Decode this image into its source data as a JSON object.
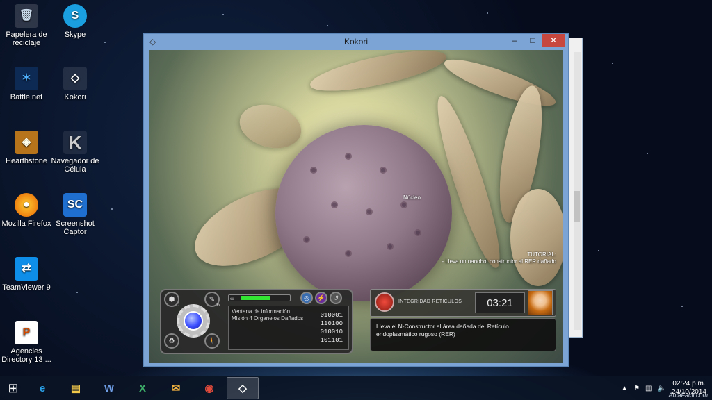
{
  "desktop": {
    "icons": [
      {
        "label": "Papelera de reciclaje",
        "icon": "recycle-bin-icon"
      },
      {
        "label": "Skype",
        "icon": "skype-icon"
      },
      {
        "label": "Battle.net",
        "icon": "battlenet-icon"
      },
      {
        "label": "Kokori",
        "icon": "unity-icon"
      },
      {
        "label": "Hearthstone",
        "icon": "hearthstone-icon"
      },
      {
        "label": "Navegador de Célula",
        "icon": "k-icon"
      },
      {
        "label": "Mozilla Firefox",
        "icon": "firefox-icon"
      },
      {
        "label": "Screenshot Captor",
        "icon": "sc-icon"
      },
      {
        "label": "TeamViewer 9",
        "icon": "teamviewer-icon"
      },
      {
        "label": "Agencies Directory 13 ...",
        "icon": "document-icon"
      }
    ]
  },
  "window": {
    "title": "Kokori",
    "minimize": "–",
    "maximize": "□",
    "close": "✕"
  },
  "game": {
    "nucleus_label": "Núcleo",
    "tutorial_title": "TUTORIAL:",
    "tutorial_text": "- Lleva un nanobot constructor al RER dañado",
    "hud": {
      "counts": [
        "0",
        "6"
      ],
      "energy_fraction": 0.6,
      "info_title": "Ventana de información",
      "info_mission": "Misión 4 Organelos Dañados",
      "binary": [
        "010001",
        "110100",
        "010010",
        "101101"
      ]
    },
    "integrity_label": "INTEGRIDAD RETICULOS",
    "timer": "03:21",
    "instruction": "Lleva el N-Constructor al área dañada del Retículo endoplasmático rugoso (RER)"
  },
  "taskbar": {
    "apps": [
      {
        "name": "internet-explorer",
        "glyph": "e",
        "color": "#2aa0e8"
      },
      {
        "name": "file-explorer",
        "glyph": "▤",
        "color": "#f2c84b"
      },
      {
        "name": "word",
        "glyph": "W",
        "color": "#2b579a"
      },
      {
        "name": "excel",
        "glyph": "X",
        "color": "#217346"
      },
      {
        "name": "mail",
        "glyph": "✉",
        "color": "#f0b040"
      },
      {
        "name": "chrome",
        "glyph": "◉",
        "color": "#e14b3b"
      },
      {
        "name": "unity",
        "glyph": "◇",
        "color": "#ffffff"
      }
    ],
    "time": "02:24 p.m.",
    "date": "24/10/2014"
  },
  "watermark": "AulaFacil.com",
  "colors": {
    "accent": "#7ca5d6",
    "close": "#c7463e",
    "energy": "#33e633"
  }
}
